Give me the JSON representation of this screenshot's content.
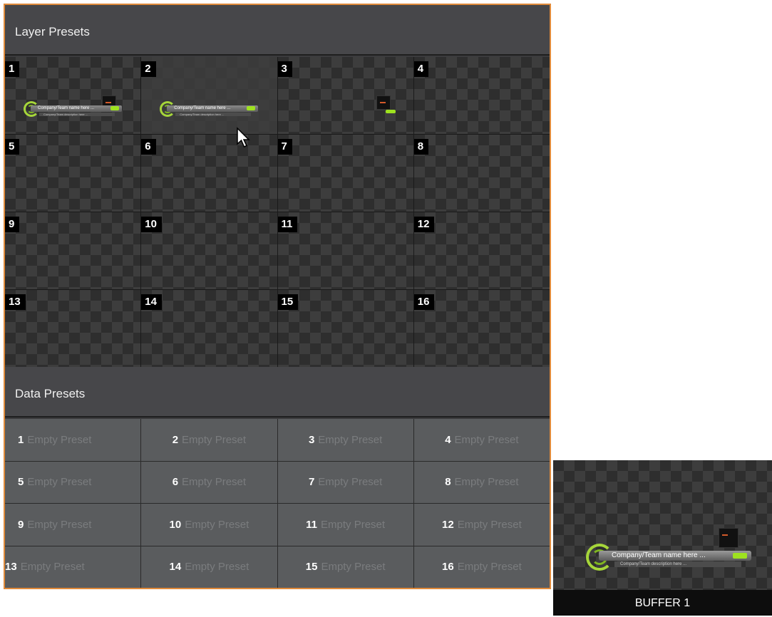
{
  "layer_presets": {
    "title": "Layer Presets",
    "cells": [
      {
        "number": "1"
      },
      {
        "number": "2"
      },
      {
        "number": "3"
      },
      {
        "number": "4"
      },
      {
        "number": "5"
      },
      {
        "number": "6"
      },
      {
        "number": "7"
      },
      {
        "number": "8"
      },
      {
        "number": "9"
      },
      {
        "number": "10"
      },
      {
        "number": "11"
      },
      {
        "number": "12"
      },
      {
        "number": "13"
      },
      {
        "number": "14"
      },
      {
        "number": "15"
      },
      {
        "number": "16"
      }
    ],
    "lower_third": {
      "headline": "Company/Team name here ...",
      "subline": "Company/Team description here ..."
    }
  },
  "data_presets": {
    "title": "Data Presets",
    "empty_label": "Empty Preset",
    "cells": [
      {
        "number": "1",
        "label": "Empty Preset"
      },
      {
        "number": "2",
        "label": "Empty Preset"
      },
      {
        "number": "3",
        "label": "Empty Preset"
      },
      {
        "number": "4",
        "label": "Empty Preset"
      },
      {
        "number": "5",
        "label": "Empty Preset"
      },
      {
        "number": "6",
        "label": "Empty Preset"
      },
      {
        "number": "7",
        "label": "Empty Preset"
      },
      {
        "number": "8",
        "label": "Empty Preset"
      },
      {
        "number": "9",
        "label": "Empty Preset"
      },
      {
        "number": "10",
        "label": "Empty Preset"
      },
      {
        "number": "11",
        "label": "Empty Preset"
      },
      {
        "number": "12",
        "label": "Empty Preset"
      },
      {
        "number": "13",
        "label": "Empty Preset"
      },
      {
        "number": "14",
        "label": "Empty Preset"
      },
      {
        "number": "15",
        "label": "Empty Preset"
      },
      {
        "number": "16",
        "label": "Empty Preset"
      }
    ]
  },
  "buffer": {
    "label": "BUFFER 1",
    "headline": "Company/Team name here ...",
    "subline": "Company/Team description here ..."
  },
  "colors": {
    "panel_border": "#e08a3a",
    "accent_green": "#9ee21f"
  }
}
